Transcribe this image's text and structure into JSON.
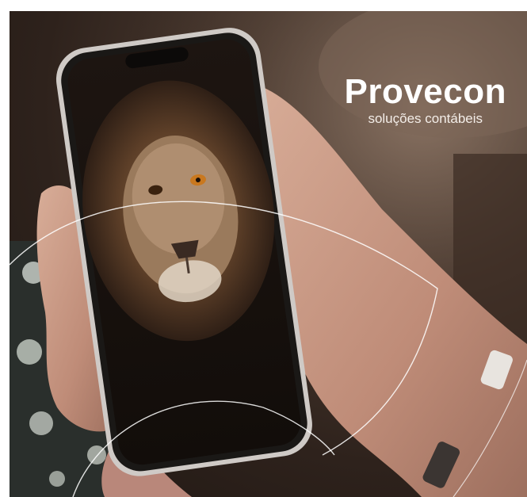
{
  "brand": {
    "name": "Provecon",
    "tagline": "soluções contábeis"
  },
  "colors": {
    "background": "#2e221c",
    "skin": "#c99a86",
    "phone_frame": "#1a1816",
    "lion_fur": "#6b4a2c",
    "accent_line": "#ffffff"
  },
  "scene": {
    "phone_screen_subject": "lion-portrait"
  }
}
